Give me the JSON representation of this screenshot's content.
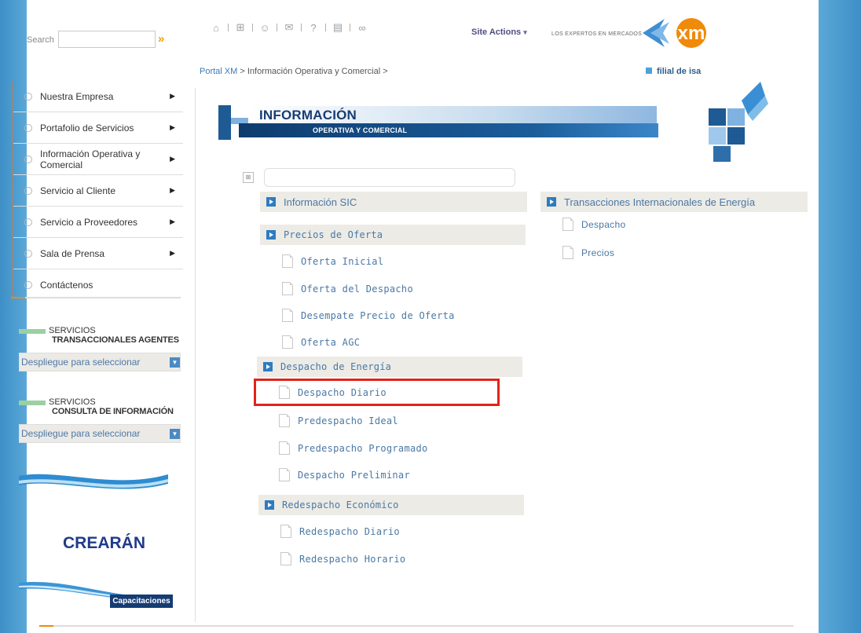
{
  "header": {
    "search_label": "Search",
    "site_actions": "Site Actions",
    "brand_tagline": "LOS EXPERTOS EN MERCADOS",
    "logo_text": "xm",
    "toolbar_icons": [
      "home-icon",
      "sitemap-icon",
      "users-icon",
      "mail-icon",
      "help-icon",
      "document-icon",
      "glasses-icon"
    ]
  },
  "breadcrumb": {
    "root": "Portal XM",
    "sep": " > ",
    "current": "Información Operativa y Comercial",
    "trail": " >"
  },
  "filial": "filial de isa",
  "nav": {
    "items": [
      {
        "label": "Nuestra Empresa",
        "arrow": true
      },
      {
        "label": "Portafolio de Servicios",
        "arrow": true
      },
      {
        "label": "Información Operativa y Comercial",
        "arrow": true
      },
      {
        "label": "Servicio al Cliente",
        "arrow": true
      },
      {
        "label": "Servicio a Proveedores",
        "arrow": true
      },
      {
        "label": "Sala de Prensa",
        "arrow": true
      },
      {
        "label": "Contáctenos",
        "arrow": false
      }
    ]
  },
  "services": [
    {
      "line1": "SERVICIOS",
      "line2": "TRANSACCIONALES AGENTES",
      "dropdown": "Despliegue para seleccionar"
    },
    {
      "line1": "SERVICIOS",
      "line2": "CONSULTA DE INFORMACIÓN",
      "dropdown": "Despliegue para seleccionar"
    }
  ],
  "banners": {
    "crearan": "CREARÁN",
    "capacitaciones": "Capacitaciones"
  },
  "section": {
    "title": "INFORMACIÓN",
    "subtitle": "OPERATIVA Y COMERCIAL"
  },
  "tree": {
    "left": [
      {
        "label": "Información SIC",
        "links": []
      },
      {
        "label": "Precios de Oferta",
        "links": [
          "Oferta Inicial",
          "Oferta del Despacho",
          "Desempate Precio de Oferta",
          "Oferta AGC"
        ]
      },
      {
        "label": "Despacho de Energía",
        "links": [
          "Despacho Diario",
          "Predespacho Ideal",
          "Predespacho Programado",
          "Despacho Preliminar"
        ]
      },
      {
        "label": "Redespacho Económico",
        "links": [
          "Redespacho Diario",
          "Redespacho Horario"
        ]
      }
    ],
    "right": [
      {
        "label": "Transacciones Internacionales de Energía",
        "links": [
          "Despacho",
          "Precios"
        ]
      }
    ]
  }
}
